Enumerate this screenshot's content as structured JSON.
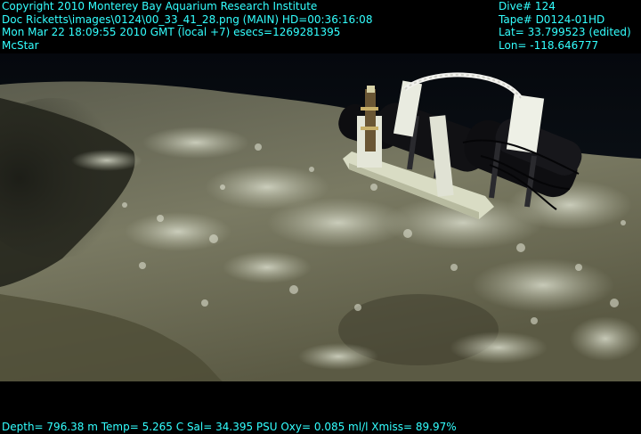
{
  "overlay": {
    "top_left": [
      "Copyright 2010 Monterey Bay Aquarium Research Institute",
      "Doc Ricketts\\images\\0124\\00_33_41_28.png (MAIN)  HD=00:36:16:08",
      "Mon Mar 22 18:09:55 2010 GMT (local +7)  esecs=1269281395",
      "McStar"
    ],
    "top_right": [
      "Dive# 124",
      "Tape# D0124-01HD",
      "Lat= 33.799523 (edited)",
      "Lon= -118.646777"
    ],
    "bottom": "Depth= 796.38 m  Temp= 5.265 C  Sal= 34.395 PSU  Oxy= 0.085 ml/l  Xmiss= 89.97%"
  },
  "colors": {
    "overlay_text": "#33ffff",
    "water": "#0a1018",
    "seafloor": "#6f6e5a",
    "instrument_frame": "#e8eadc",
    "instrument_housing": "#111114"
  }
}
